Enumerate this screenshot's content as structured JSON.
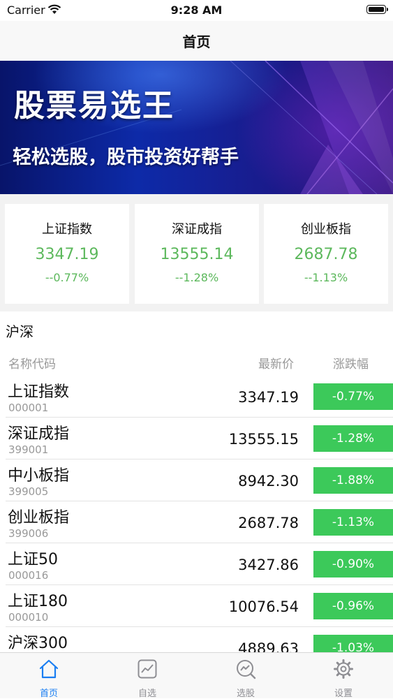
{
  "status_bar": {
    "carrier": "Carrier",
    "time": "9:28 AM"
  },
  "nav": {
    "title": "首页"
  },
  "banner": {
    "title": "股票易选王",
    "subtitle": "轻松选股，股市投资好帮手"
  },
  "index_cards": [
    {
      "name": "上证指数",
      "value": "3347.19",
      "change": "--0.77%"
    },
    {
      "name": "深证成指",
      "value": "13555.14",
      "change": "--1.28%"
    },
    {
      "name": "创业板指",
      "value": "2687.78",
      "change": "--1.13%"
    }
  ],
  "section": {
    "title": "沪深",
    "columns": {
      "name_code": "名称代码",
      "latest_price": "最新价",
      "change_pct": "涨跌幅"
    }
  },
  "stocks": [
    {
      "name": "上证指数",
      "code": "000001",
      "price": "3347.19",
      "change": "-0.77%"
    },
    {
      "name": "深证成指",
      "code": "399001",
      "price": "13555.15",
      "change": "-1.28%"
    },
    {
      "name": "中小板指",
      "code": "399005",
      "price": "8942.30",
      "change": "-1.88%"
    },
    {
      "name": "创业板指",
      "code": "399006",
      "price": "2687.78",
      "change": "-1.13%"
    },
    {
      "name": "上证50",
      "code": "000016",
      "price": "3427.86",
      "change": "-0.90%"
    },
    {
      "name": "上证180",
      "code": "000010",
      "price": "10076.54",
      "change": "-0.96%"
    },
    {
      "name": "沪深300",
      "code": "",
      "price": "4889.63",
      "change": "-1.03%"
    }
  ],
  "tabs": [
    {
      "label": "首页",
      "icon": "home-icon",
      "active": true
    },
    {
      "label": "自选",
      "icon": "chart-icon",
      "active": false
    },
    {
      "label": "选股",
      "icon": "search-trend-icon",
      "active": false
    },
    {
      "label": "设置",
      "icon": "gear-icon",
      "active": false
    }
  ],
  "colors": {
    "up_green": "#5cb85c",
    "badge_green": "#3cc95a",
    "tab_active": "#1a7ef2",
    "tab_inactive": "#8e8e93"
  }
}
